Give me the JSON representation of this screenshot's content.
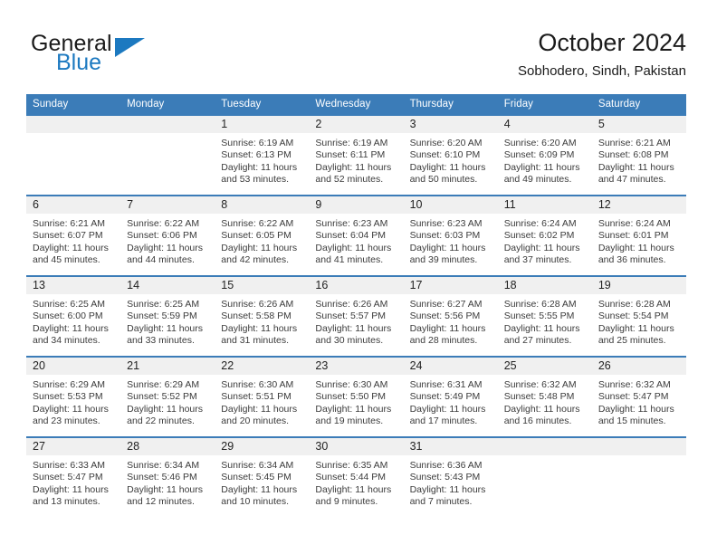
{
  "brand": {
    "name_part1": "General",
    "name_part2": "Blue",
    "triangle_color": "#1c79c0"
  },
  "header": {
    "title": "October 2024",
    "subtitle": "Sobhodero, Sindh, Pakistan"
  },
  "theme": {
    "header_blue": "#3b7cb8",
    "band_gray": "#f0f0f0",
    "text_dark": "#222222",
    "text_body": "#3b3b3b"
  },
  "weekdays": [
    "Sunday",
    "Monday",
    "Tuesday",
    "Wednesday",
    "Thursday",
    "Friday",
    "Saturday"
  ],
  "weeks": [
    [
      {
        "day": "",
        "sunrise": "",
        "sunset": "",
        "daylight": ""
      },
      {
        "day": "",
        "sunrise": "",
        "sunset": "",
        "daylight": ""
      },
      {
        "day": "1",
        "sunrise": "Sunrise: 6:19 AM",
        "sunset": "Sunset: 6:13 PM",
        "daylight": "Daylight: 11 hours and 53 minutes."
      },
      {
        "day": "2",
        "sunrise": "Sunrise: 6:19 AM",
        "sunset": "Sunset: 6:11 PM",
        "daylight": "Daylight: 11 hours and 52 minutes."
      },
      {
        "day": "3",
        "sunrise": "Sunrise: 6:20 AM",
        "sunset": "Sunset: 6:10 PM",
        "daylight": "Daylight: 11 hours and 50 minutes."
      },
      {
        "day": "4",
        "sunrise": "Sunrise: 6:20 AM",
        "sunset": "Sunset: 6:09 PM",
        "daylight": "Daylight: 11 hours and 49 minutes."
      },
      {
        "day": "5",
        "sunrise": "Sunrise: 6:21 AM",
        "sunset": "Sunset: 6:08 PM",
        "daylight": "Daylight: 11 hours and 47 minutes."
      }
    ],
    [
      {
        "day": "6",
        "sunrise": "Sunrise: 6:21 AM",
        "sunset": "Sunset: 6:07 PM",
        "daylight": "Daylight: 11 hours and 45 minutes."
      },
      {
        "day": "7",
        "sunrise": "Sunrise: 6:22 AM",
        "sunset": "Sunset: 6:06 PM",
        "daylight": "Daylight: 11 hours and 44 minutes."
      },
      {
        "day": "8",
        "sunrise": "Sunrise: 6:22 AM",
        "sunset": "Sunset: 6:05 PM",
        "daylight": "Daylight: 11 hours and 42 minutes."
      },
      {
        "day": "9",
        "sunrise": "Sunrise: 6:23 AM",
        "sunset": "Sunset: 6:04 PM",
        "daylight": "Daylight: 11 hours and 41 minutes."
      },
      {
        "day": "10",
        "sunrise": "Sunrise: 6:23 AM",
        "sunset": "Sunset: 6:03 PM",
        "daylight": "Daylight: 11 hours and 39 minutes."
      },
      {
        "day": "11",
        "sunrise": "Sunrise: 6:24 AM",
        "sunset": "Sunset: 6:02 PM",
        "daylight": "Daylight: 11 hours and 37 minutes."
      },
      {
        "day": "12",
        "sunrise": "Sunrise: 6:24 AM",
        "sunset": "Sunset: 6:01 PM",
        "daylight": "Daylight: 11 hours and 36 minutes."
      }
    ],
    [
      {
        "day": "13",
        "sunrise": "Sunrise: 6:25 AM",
        "sunset": "Sunset: 6:00 PM",
        "daylight": "Daylight: 11 hours and 34 minutes."
      },
      {
        "day": "14",
        "sunrise": "Sunrise: 6:25 AM",
        "sunset": "Sunset: 5:59 PM",
        "daylight": "Daylight: 11 hours and 33 minutes."
      },
      {
        "day": "15",
        "sunrise": "Sunrise: 6:26 AM",
        "sunset": "Sunset: 5:58 PM",
        "daylight": "Daylight: 11 hours and 31 minutes."
      },
      {
        "day": "16",
        "sunrise": "Sunrise: 6:26 AM",
        "sunset": "Sunset: 5:57 PM",
        "daylight": "Daylight: 11 hours and 30 minutes."
      },
      {
        "day": "17",
        "sunrise": "Sunrise: 6:27 AM",
        "sunset": "Sunset: 5:56 PM",
        "daylight": "Daylight: 11 hours and 28 minutes."
      },
      {
        "day": "18",
        "sunrise": "Sunrise: 6:28 AM",
        "sunset": "Sunset: 5:55 PM",
        "daylight": "Daylight: 11 hours and 27 minutes."
      },
      {
        "day": "19",
        "sunrise": "Sunrise: 6:28 AM",
        "sunset": "Sunset: 5:54 PM",
        "daylight": "Daylight: 11 hours and 25 minutes."
      }
    ],
    [
      {
        "day": "20",
        "sunrise": "Sunrise: 6:29 AM",
        "sunset": "Sunset: 5:53 PM",
        "daylight": "Daylight: 11 hours and 23 minutes."
      },
      {
        "day": "21",
        "sunrise": "Sunrise: 6:29 AM",
        "sunset": "Sunset: 5:52 PM",
        "daylight": "Daylight: 11 hours and 22 minutes."
      },
      {
        "day": "22",
        "sunrise": "Sunrise: 6:30 AM",
        "sunset": "Sunset: 5:51 PM",
        "daylight": "Daylight: 11 hours and 20 minutes."
      },
      {
        "day": "23",
        "sunrise": "Sunrise: 6:30 AM",
        "sunset": "Sunset: 5:50 PM",
        "daylight": "Daylight: 11 hours and 19 minutes."
      },
      {
        "day": "24",
        "sunrise": "Sunrise: 6:31 AM",
        "sunset": "Sunset: 5:49 PM",
        "daylight": "Daylight: 11 hours and 17 minutes."
      },
      {
        "day": "25",
        "sunrise": "Sunrise: 6:32 AM",
        "sunset": "Sunset: 5:48 PM",
        "daylight": "Daylight: 11 hours and 16 minutes."
      },
      {
        "day": "26",
        "sunrise": "Sunrise: 6:32 AM",
        "sunset": "Sunset: 5:47 PM",
        "daylight": "Daylight: 11 hours and 15 minutes."
      }
    ],
    [
      {
        "day": "27",
        "sunrise": "Sunrise: 6:33 AM",
        "sunset": "Sunset: 5:47 PM",
        "daylight": "Daylight: 11 hours and 13 minutes."
      },
      {
        "day": "28",
        "sunrise": "Sunrise: 6:34 AM",
        "sunset": "Sunset: 5:46 PM",
        "daylight": "Daylight: 11 hours and 12 minutes."
      },
      {
        "day": "29",
        "sunrise": "Sunrise: 6:34 AM",
        "sunset": "Sunset: 5:45 PM",
        "daylight": "Daylight: 11 hours and 10 minutes."
      },
      {
        "day": "30",
        "sunrise": "Sunrise: 6:35 AM",
        "sunset": "Sunset: 5:44 PM",
        "daylight": "Daylight: 11 hours and 9 minutes."
      },
      {
        "day": "31",
        "sunrise": "Sunrise: 6:36 AM",
        "sunset": "Sunset: 5:43 PM",
        "daylight": "Daylight: 11 hours and 7 minutes."
      },
      {
        "day": "",
        "sunrise": "",
        "sunset": "",
        "daylight": ""
      },
      {
        "day": "",
        "sunrise": "",
        "sunset": "",
        "daylight": ""
      }
    ]
  ]
}
